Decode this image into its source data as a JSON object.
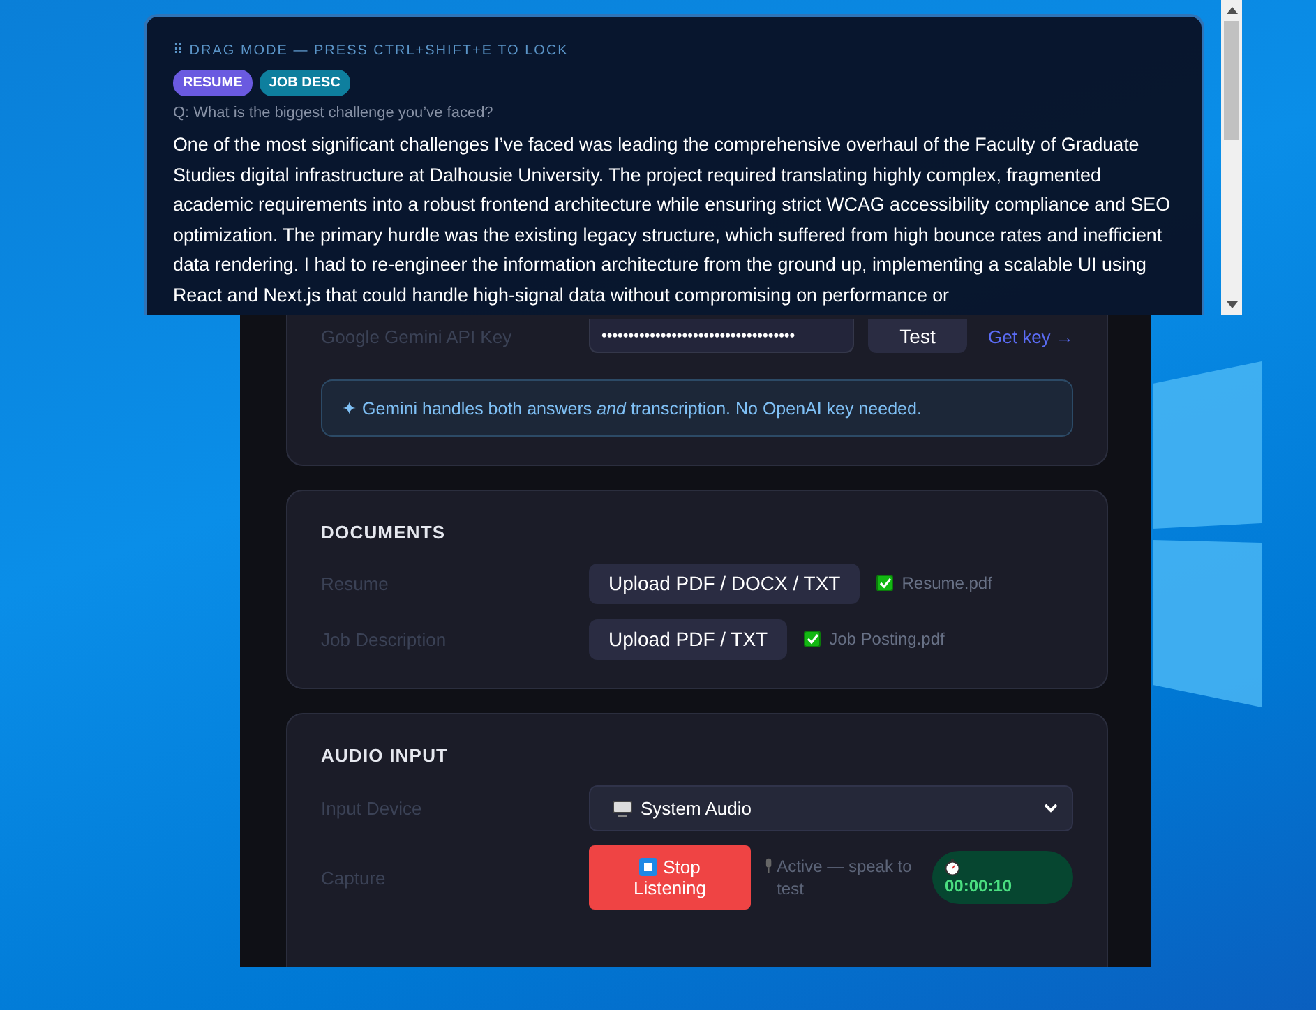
{
  "overlay": {
    "hint": "⠿ DRAG MODE — PRESS CTRL+SHIFT+E TO LOCK",
    "badges": [
      {
        "label": "RESUME",
        "color": "#6a5ae0"
      },
      {
        "label": "JOB DESC",
        "color": "#0e7f9e"
      }
    ],
    "question": "Q: What is the biggest challenge you’ve faced?",
    "answer": "One of the most significant challenges I’ve faced was leading the comprehensive overhaul of the Faculty of Graduate Studies digital infrastructure at Dalhousie University. The project required translating highly complex, fragmented academic requirements into a robust frontend architecture while ensuring strict WCAG accessibility compliance and SEO optimization. The primary hurdle was the existing legacy structure, which suffered from high bounce rates and inefficient data rendering. I had to re-engineer the information architecture from the ground up, implementing a scalable UI using React and Next.js that could handle high-signal data without compromising on performance or"
  },
  "settings": {
    "api": {
      "label": "Google Gemini API Key",
      "key_value": "••••••••••••••••••••••••••••••••••••",
      "test_button": "Test",
      "link": "Get key →",
      "note": "✦ Gemini handles both answers *and* transcription. No OpenAI key needed."
    },
    "documents": {
      "title": "DOCUMENTS",
      "rows": [
        {
          "label": "Resume",
          "button": "Upload PDF / DOCX / TXT",
          "file": "Resume.pdf",
          "checked": true
        },
        {
          "label": "Job Description",
          "button": "Upload PDF / TXT",
          "file": "Job Posting.pdf",
          "checked": true
        }
      ]
    },
    "audio": {
      "title": "AUDIO INPUT",
      "device_label": "Input Device",
      "device": "System Audio",
      "capture_label": "Capture",
      "stop_button": "Stop Listening",
      "status": "Active — speak to test",
      "timer": "00:00:10"
    }
  }
}
